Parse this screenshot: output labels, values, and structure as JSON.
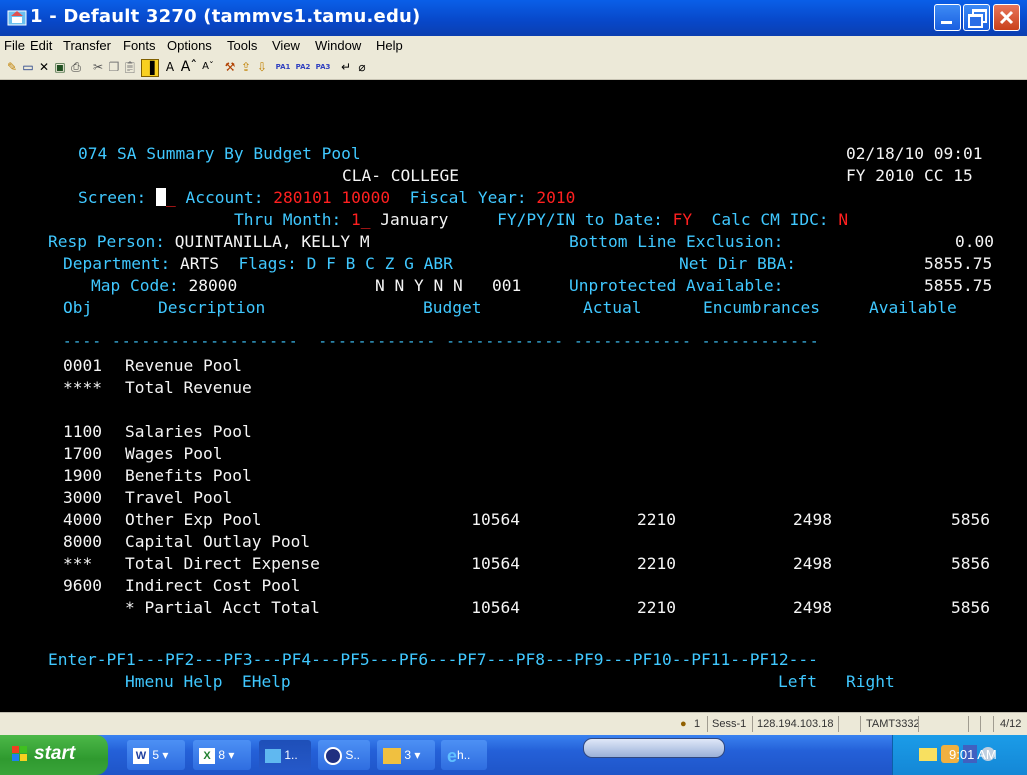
{
  "window": {
    "title": "1 - Default 3270 (tammvs1.tamu.edu)"
  },
  "menu": {
    "items": [
      "File",
      "Edit",
      "Transfer",
      "Fonts",
      "Options",
      "Tools",
      "View",
      "Window",
      "Help"
    ]
  },
  "toolbar": {
    "pa1": "PA1",
    "pa2": "PA2",
    "pa3": "PA3"
  },
  "screen": {
    "l1_title": "074 SA Summary By Budget Pool",
    "l1_datetime": "02/18/10 09:01",
    "l2_college": "CLA- COLLEGE",
    "l2_fy": "FY 2010 CC 15",
    "screen_label": "Screen:",
    "account_label": "Account:",
    "account_value": "280101 10000",
    "fiscal_label": "Fiscal Year:",
    "fiscal_value": "2010",
    "thru_label": "Thru Month:",
    "thru_value": "1",
    "thru_month": "January",
    "todate_label": "FY/PY/IN to Date:",
    "todate_value": "FY",
    "calc_label": "Calc CM IDC:",
    "calc_value": "N",
    "resp_label": "Resp Person:",
    "resp_value": "QUINTANILLA, KELLY M",
    "ble_label": "Bottom Line Exclusion:",
    "ble_value": "0.00",
    "dept_label": "Department:",
    "dept_value": "ARTS",
    "flags_label": "Flags:",
    "flags_letters": "D F B C Z G ABR",
    "netdir_label": "Net Dir BBA:",
    "netdir_value": "5855.75",
    "map_label": "Map Code:",
    "map_value": "28000",
    "flags_values": "N N Y N N   001",
    "unprot_label": "Unprotected Available:",
    "unprot_value": "5855.75",
    "col_obj": "Obj",
    "col_desc": "Description",
    "col_budget": "Budget",
    "col_actual": "Actual",
    "col_encumb": "Encumbrances",
    "col_avail": "Available",
    "dashes": "---- -------------------  ------------ ------------ ------------ ------------",
    "rows": [
      {
        "obj": "0001",
        "desc": "Revenue Pool",
        "budget": "",
        "actual": "",
        "encumb": "",
        "avail": ""
      },
      {
        "obj": "****",
        "desc": "Total Revenue",
        "budget": "",
        "actual": "",
        "encumb": "",
        "avail": ""
      },
      {
        "obj": "",
        "desc": "",
        "budget": "",
        "actual": "",
        "encumb": "",
        "avail": ""
      },
      {
        "obj": "1100",
        "desc": "Salaries Pool",
        "budget": "",
        "actual": "",
        "encumb": "",
        "avail": ""
      },
      {
        "obj": "1700",
        "desc": "Wages Pool",
        "budget": "",
        "actual": "",
        "encumb": "",
        "avail": ""
      },
      {
        "obj": "1900",
        "desc": "Benefits Pool",
        "budget": "",
        "actual": "",
        "encumb": "",
        "avail": ""
      },
      {
        "obj": "3000",
        "desc": "Travel Pool",
        "budget": "",
        "actual": "",
        "encumb": "",
        "avail": ""
      },
      {
        "obj": "4000",
        "desc": "Other Exp Pool",
        "budget": "10564",
        "actual": "2210",
        "encumb": "2498",
        "avail": "5856"
      },
      {
        "obj": "8000",
        "desc": "Capital Outlay Pool",
        "budget": "",
        "actual": "",
        "encumb": "",
        "avail": ""
      },
      {
        "obj": "***",
        "desc": "Total Direct Expense",
        "budget": "10564",
        "actual": "2210",
        "encumb": "2498",
        "avail": "5856"
      },
      {
        "obj": "9600",
        "desc": "Indirect Cost Pool",
        "budget": "",
        "actual": "",
        "encumb": "",
        "avail": ""
      },
      {
        "obj": "",
        "desc": "* Partial Acct Total",
        "budget": "10564",
        "actual": "2210",
        "encumb": "2498",
        "avail": "5856"
      }
    ],
    "pf_line": "Enter-PF1---PF2---PF3---PF4---PF5---PF6---PF7---PF8---PF9---PF10--PF11--PF12---",
    "pf_labels": "Hmenu Help  EHelp",
    "pf_left": "Left",
    "pf_right": "Right"
  },
  "status": {
    "session_num": "1",
    "session": "Sess-1",
    "ip": "128.194.103.18",
    "terminal": "TAMT3332",
    "pos": "4/12"
  },
  "taskbar": {
    "start": "start",
    "items": [
      "5",
      "8",
      "1..",
      "S..",
      "3",
      "h.."
    ],
    "clock": "9:01 AM"
  },
  "colors": {
    "terminal_bg": "#000000",
    "cyan": "#40c8ff",
    "green": "#3ce04a",
    "red": "#ff2020",
    "titlebar": "#0a5fe8"
  }
}
